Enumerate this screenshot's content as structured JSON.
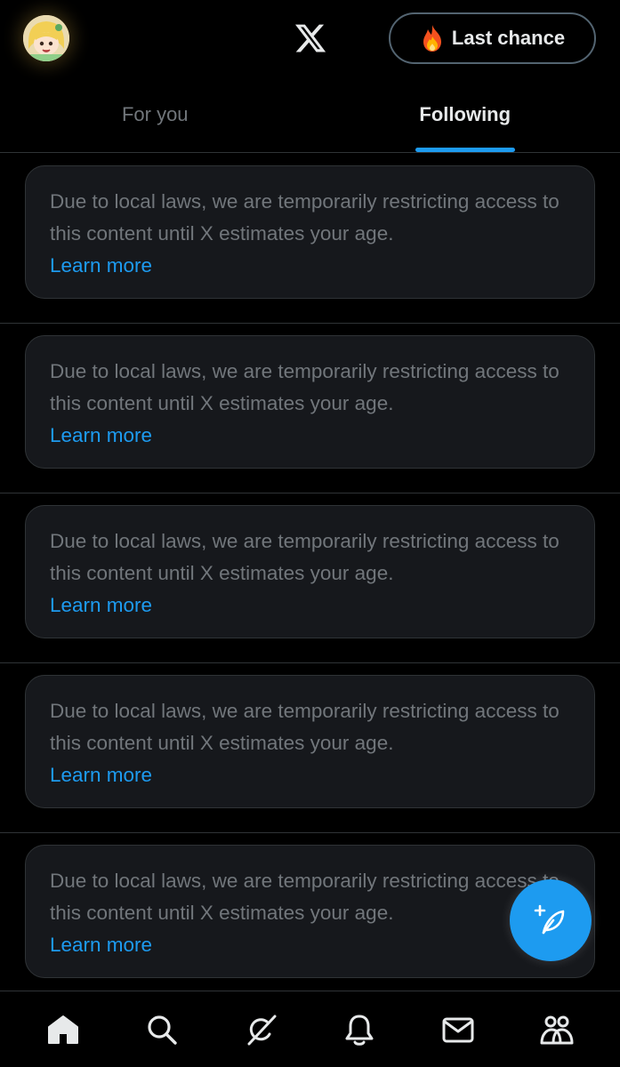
{
  "header": {
    "avatar_icon": "profile-avatar",
    "logo_icon": "x-logo-icon",
    "premium_button": {
      "icon": "fire-icon",
      "label": "Last chance"
    }
  },
  "tabs": [
    {
      "label": "For you",
      "active": false
    },
    {
      "label": "Following",
      "active": true
    }
  ],
  "feed": {
    "items": [
      {
        "message": "Due to local laws, we are temporarily restricting access to this content until X estimates your age.",
        "link": "Learn more"
      },
      {
        "message": "Due to local laws, we are temporarily restricting access to this content until X estimates your age.",
        "link": "Learn more"
      },
      {
        "message": "Due to local laws, we are temporarily restricting access to this content until X estimates your age.",
        "link": "Learn more"
      },
      {
        "message": "Due to local laws, we are temporarily restricting access to this content until X estimates your age.",
        "link": "Learn more"
      },
      {
        "message": "Due to local laws, we are temporarily restricting access to this content until X estimates your age.",
        "link": "Learn more"
      }
    ]
  },
  "fab": {
    "icon": "compose-post-icon"
  },
  "bottom_nav": [
    {
      "icon": "home-icon",
      "active": true
    },
    {
      "icon": "search-icon",
      "active": false
    },
    {
      "icon": "grok-icon",
      "active": false
    },
    {
      "icon": "notifications-icon",
      "active": false
    },
    {
      "icon": "messages-icon",
      "active": false
    },
    {
      "icon": "communities-icon",
      "active": false
    }
  ],
  "colors": {
    "background": "#000000",
    "accent": "#1d9bf0",
    "card": "#16181c",
    "border": "#2f3336",
    "muted_text": "#71767b",
    "primary_text": "#e7e9ea"
  }
}
